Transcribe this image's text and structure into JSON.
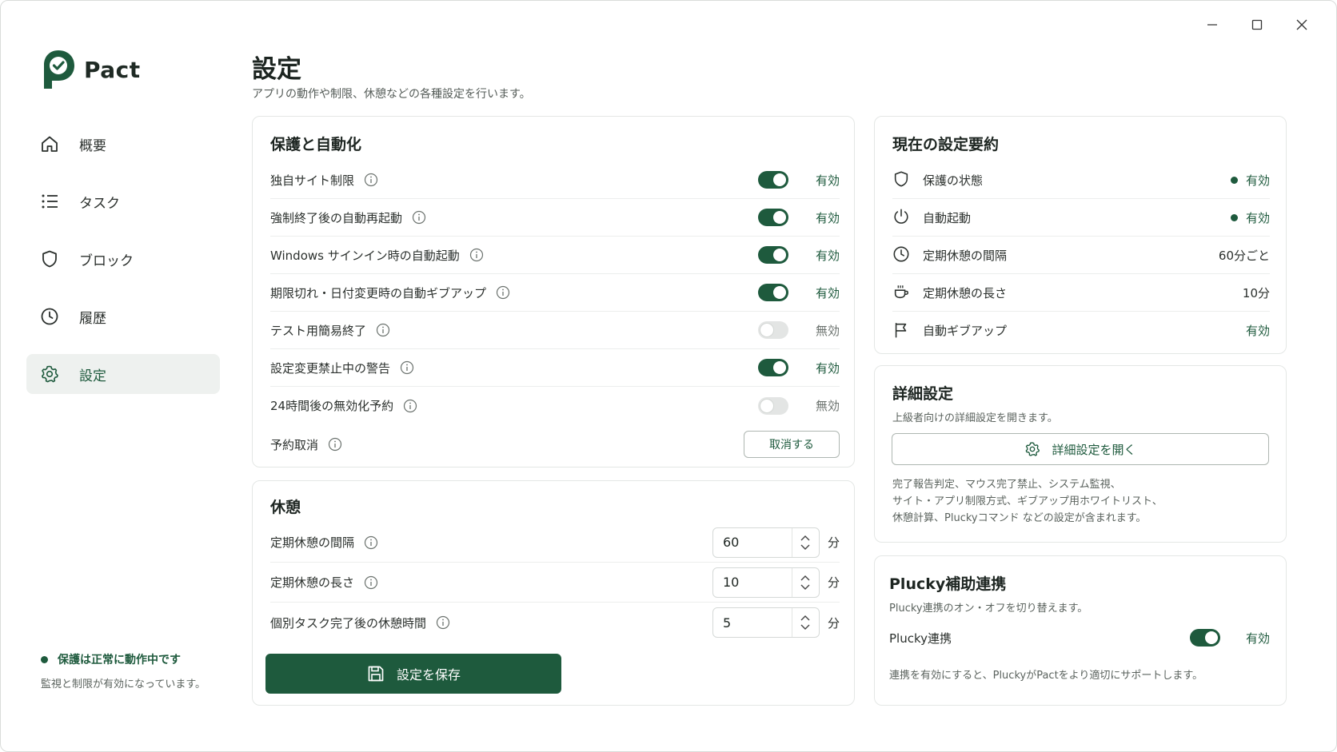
{
  "app": {
    "name": "Pact"
  },
  "colors": {
    "accent": "#1e5a3d",
    "toggle_off": "#e3e5e4",
    "border": "#e4e7e5"
  },
  "window_controls": {
    "minimize_icon": "minimize-icon",
    "maximize_icon": "maximize-icon",
    "close_icon": "close-icon"
  },
  "sidebar": {
    "items": [
      {
        "label": "概要",
        "icon": "home-icon"
      },
      {
        "label": "タスク",
        "icon": "list-icon"
      },
      {
        "label": "ブロック",
        "icon": "shield-icon"
      },
      {
        "label": "履歴",
        "icon": "clock-icon"
      },
      {
        "label": "設定",
        "icon": "gear-icon",
        "active": true
      }
    ],
    "status": {
      "title": "保護は正常に動作中です",
      "subtitle": "監視と制限が有効になっています。"
    }
  },
  "header": {
    "title": "設定",
    "subtitle": "アプリの動作や制限、休憩などの各種設定を行います。"
  },
  "protection": {
    "title": "保護と自動化",
    "rows": [
      {
        "label": "独自サイト制限",
        "on": true,
        "state": "有効"
      },
      {
        "label": "強制終了後の自動再起動",
        "on": true,
        "state": "有効"
      },
      {
        "label": "Windows サインイン時の自動起動",
        "on": true,
        "state": "有効"
      },
      {
        "label": "期限切れ・日付変更時の自動ギブアップ",
        "on": true,
        "state": "有効"
      },
      {
        "label": "テスト用簡易終了",
        "on": false,
        "state": "無効"
      },
      {
        "label": "設定変更禁止中の警告",
        "on": true,
        "state": "有効"
      },
      {
        "label": "24時間後の無効化予約",
        "on": false,
        "state": "無効"
      }
    ],
    "cancel_row": {
      "label": "予約取消",
      "button": "取消する"
    }
  },
  "break": {
    "title": "休憩",
    "rows": [
      {
        "label": "定期休憩の間隔",
        "value": "60",
        "unit": "分"
      },
      {
        "label": "定期休憩の長さ",
        "value": "10",
        "unit": "分"
      },
      {
        "label": "個別タスク完了後の休憩時間",
        "value": "5",
        "unit": "分"
      }
    ],
    "save_button": "設定を保存"
  },
  "summary": {
    "title": "現在の設定要約",
    "rows": [
      {
        "label": "保護の状態",
        "value": "有効",
        "icon": "shield-icon",
        "dot": true,
        "green": true
      },
      {
        "label": "自動起動",
        "value": "有効",
        "icon": "power-icon",
        "dot": true,
        "green": true
      },
      {
        "label": "定期休憩の間隔",
        "value": "60分ごと",
        "icon": "clock-icon",
        "dot": false,
        "green": false
      },
      {
        "label": "定期休憩の長さ",
        "value": "10分",
        "icon": "coffee-icon",
        "dot": false,
        "green": false
      },
      {
        "label": "自動ギブアップ",
        "value": "有効",
        "icon": "flag-icon",
        "dot": false,
        "green": true
      }
    ]
  },
  "advanced": {
    "title": "詳細設定",
    "subtitle": "上級者向けの詳細設定を開きます。",
    "button": "詳細設定を開く",
    "desc_lines": [
      "完了報告判定、マウス完了禁止、システム監視、",
      "サイト・アプリ制限方式、ギブアップ用ホワイトリスト、",
      "休憩計算、Pluckyコマンド などの設定が含まれます。"
    ]
  },
  "plucky": {
    "title": "Plucky補助連携",
    "subtitle": "Plucky連携のオン・オフを切り替えます。",
    "label": "Plucky連携",
    "on": true,
    "state": "有効",
    "desc": "連携を有効にすると、PluckyがPactをより適切にサポートします。"
  }
}
